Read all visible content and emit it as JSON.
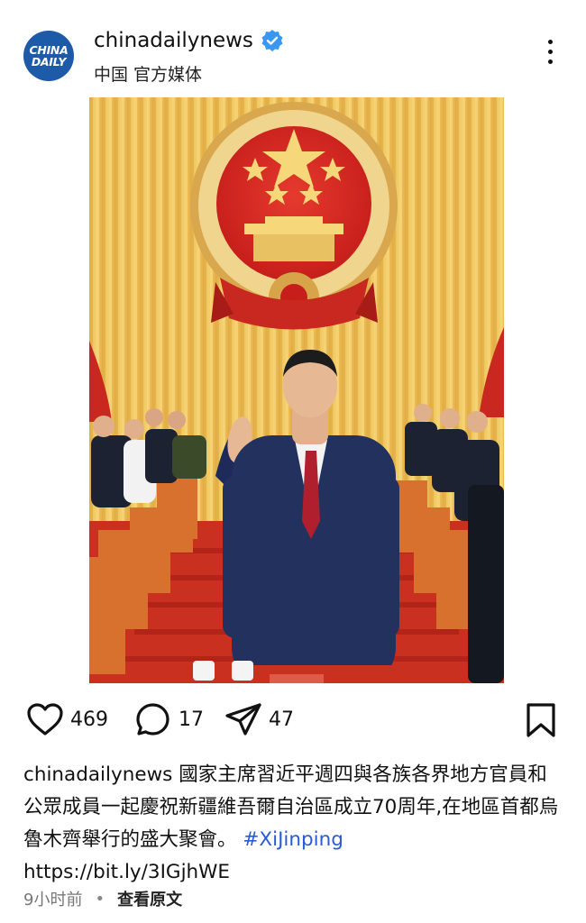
{
  "post": {
    "username": "chinadailynews",
    "verified": true,
    "subtitle": "中国 官方媒体",
    "avatar_text_line1": "CHINA",
    "avatar_text_line2": "DAILY",
    "more_icon": "more-vertical-icon"
  },
  "stats": {
    "likes": "469",
    "comments": "17",
    "shares": "47"
  },
  "caption": {
    "username": "chinadailynews",
    "text": "國家主席習近平週四與各族各界地方官員和公眾成員一起慶祝新疆維吾爾自治區成立70周年,在地區首都烏魯木齊舉行的盛大聚會。",
    "hashtag": "#XiJinping",
    "link": "https://bit.ly/3IGjhWE"
  },
  "meta": {
    "time": "9小时前",
    "separator": "•",
    "view_original": "查看原文"
  },
  "colors": {
    "link": "#2a5bd7",
    "verified": "#3897f0",
    "brand": "#1d5aa8"
  }
}
